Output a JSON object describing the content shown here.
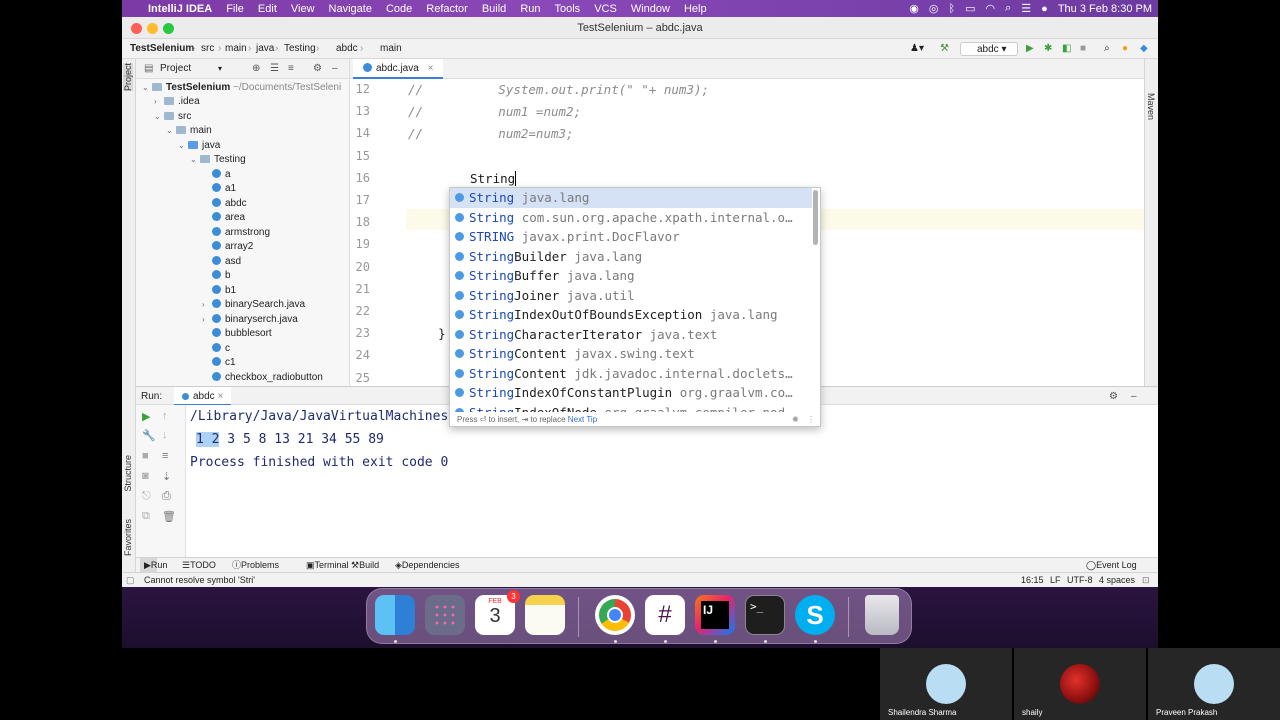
{
  "menubar": {
    "apple": "",
    "items": [
      "IntelliJ IDEA",
      "File",
      "Edit",
      "View",
      "Navigate",
      "Code",
      "Refactor",
      "Build",
      "Run",
      "Tools",
      "VCS",
      "Window",
      "Help"
    ],
    "clock": "Thu 3 Feb  8:30 PM"
  },
  "window": {
    "title": "TestSelenium – abdc.java",
    "breadcrumbs": [
      "TestSelenium",
      "src",
      "main",
      "java",
      "Testing",
      "abdc",
      "main"
    ],
    "run_config": "abdc"
  },
  "project": {
    "header": "Project",
    "root": "TestSelenium",
    "root_path": "~/Documents/TestSeleni",
    "items": [
      {
        "label": ".idea",
        "type": "folder",
        "indent": 1,
        "arrow": "›"
      },
      {
        "label": "src",
        "type": "folder",
        "indent": 1,
        "arrow": "⌄"
      },
      {
        "label": "main",
        "type": "folder",
        "indent": 2,
        "arrow": "⌄"
      },
      {
        "label": "java",
        "type": "folder-blue",
        "indent": 3,
        "arrow": "⌄"
      },
      {
        "label": "Testing",
        "type": "folder",
        "indent": 4,
        "arrow": "⌄"
      },
      {
        "label": "a",
        "type": "class",
        "indent": 5
      },
      {
        "label": "a1",
        "type": "class",
        "indent": 5
      },
      {
        "label": "abdc",
        "type": "class",
        "indent": 5
      },
      {
        "label": "area",
        "type": "class",
        "indent": 5
      },
      {
        "label": "armstrong",
        "type": "class",
        "indent": 5
      },
      {
        "label": "array2",
        "type": "class",
        "indent": 5
      },
      {
        "label": "asd",
        "type": "class",
        "indent": 5
      },
      {
        "label": "b",
        "type": "class",
        "indent": 5
      },
      {
        "label": "b1",
        "type": "class",
        "indent": 5
      },
      {
        "label": "binarySearch.java",
        "type": "class",
        "indent": 5,
        "arrow": "›"
      },
      {
        "label": "binaryserch.java",
        "type": "class",
        "indent": 5,
        "arrow": "›"
      },
      {
        "label": "bubblesort",
        "type": "class",
        "indent": 5
      },
      {
        "label": "c",
        "type": "class",
        "indent": 5
      },
      {
        "label": "c1",
        "type": "class",
        "indent": 5
      },
      {
        "label": "checkbox_radiobutton",
        "type": "class",
        "indent": 5
      }
    ]
  },
  "editor": {
    "tab": "abdc.java",
    "lines": [
      {
        "n": "12",
        "text": "//          System.out.print(\" \"+ num3);"
      },
      {
        "n": "13",
        "text": "//          num1 =num2;"
      },
      {
        "n": "14",
        "text": "//          num2=num3;"
      },
      {
        "n": "15",
        "text": ""
      },
      {
        "n": "16",
        "text": ""
      },
      {
        "n": "17",
        "text": ""
      },
      {
        "n": "18",
        "text": ""
      },
      {
        "n": "19",
        "text": ""
      },
      {
        "n": "20",
        "text": ""
      },
      {
        "n": "21",
        "text": ""
      },
      {
        "n": "22",
        "text": ""
      },
      {
        "n": "23",
        "text": "    }"
      },
      {
        "n": "24",
        "text": ""
      },
      {
        "n": "25",
        "text": ""
      }
    ],
    "typed": "String"
  },
  "completion": {
    "items": [
      {
        "match": "String",
        "rest": "",
        "pkg": "java.lang"
      },
      {
        "match": "String",
        "rest": "",
        "pkg": "com.sun.org.apache.xpath.internal.o…"
      },
      {
        "match": "STRING",
        "rest": "",
        "pkg": "javax.print.DocFlavor"
      },
      {
        "match": "String",
        "rest": "Builder",
        "pkg": "java.lang"
      },
      {
        "match": "String",
        "rest": "Buffer",
        "pkg": "java.lang"
      },
      {
        "match": "String",
        "rest": "Joiner",
        "pkg": "java.util"
      },
      {
        "match": "String",
        "rest": "IndexOutOfBoundsException",
        "pkg": "java.lang"
      },
      {
        "match": "String",
        "rest": "CharacterIterator",
        "pkg": "java.text"
      },
      {
        "match": "String",
        "rest": "Content",
        "pkg": "javax.swing.text"
      },
      {
        "match": "String",
        "rest": "Content",
        "pkg": "jdk.javadoc.internal.doclets…"
      },
      {
        "match": "String",
        "rest": "IndexOfConstantPlugin",
        "pkg": "org.graalvm.co…"
      },
      {
        "match": "String",
        "rest": "IndexOfNode",
        "pkg": "org.graalvm.compiler.nod…"
      }
    ],
    "footer": "Press ⏎ to insert, ⇥ to replace",
    "next_tip": "Next Tip"
  },
  "run": {
    "label": "Run:",
    "tab": "abdc",
    "path_line": "/Library/Java/JavaVirtualMachines/",
    "output_hl": "1 2",
    "output_rest": " 3 5 8 13 21 34 55 89",
    "exit_line": "Process finished with exit code 0"
  },
  "bottom_tools": [
    "Run",
    "TODO",
    "Problems",
    "Terminal",
    "Build",
    "Dependencies"
  ],
  "event_log": "Event Log",
  "status": {
    "message": "Cannot resolve symbol 'Stri'",
    "position": "16:15",
    "line_sep": "LF",
    "encoding": "UTF-8",
    "indent": "4 spaces"
  },
  "side_labels": {
    "left_top": "Project",
    "left_mid": "Structure",
    "left_bot": "Favorites",
    "right": "Maven"
  },
  "dock": {
    "calendar_month": "FEB",
    "calendar_day": "3",
    "calendar_badge": "3",
    "intellij": "IJ"
  },
  "participants": [
    "Shailendra Sharma",
    "shaily",
    "Praveen Prakash"
  ]
}
